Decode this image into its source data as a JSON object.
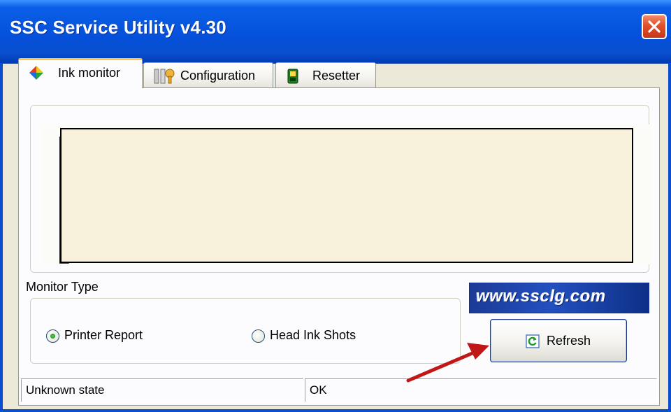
{
  "window": {
    "title": "SSC Service Utility v4.30",
    "close_icon": "close-icon"
  },
  "tabs": [
    {
      "label": "Ink monitor",
      "icon": "ink-drops-icon",
      "active": true
    },
    {
      "label": "Configuration",
      "icon": "tools-icon",
      "active": false
    },
    {
      "label": "Resetter",
      "icon": "chip-icon",
      "active": false
    }
  ],
  "monitor": {
    "group_label": "Monitor Type",
    "options": [
      {
        "label": "Printer Report",
        "selected": true
      },
      {
        "label": "Head Ink Shots",
        "selected": false
      }
    ]
  },
  "banner": {
    "text": "www.ssclg.com"
  },
  "refresh": {
    "label": "Refresh",
    "icon": "refresh-icon"
  },
  "status": {
    "left": "Unknown state",
    "right": "OK"
  },
  "colors": {
    "titlebar": "#0550da",
    "accent_tab": "#ffc83c",
    "banner": "#2350c0",
    "arrow": "#c01818"
  }
}
